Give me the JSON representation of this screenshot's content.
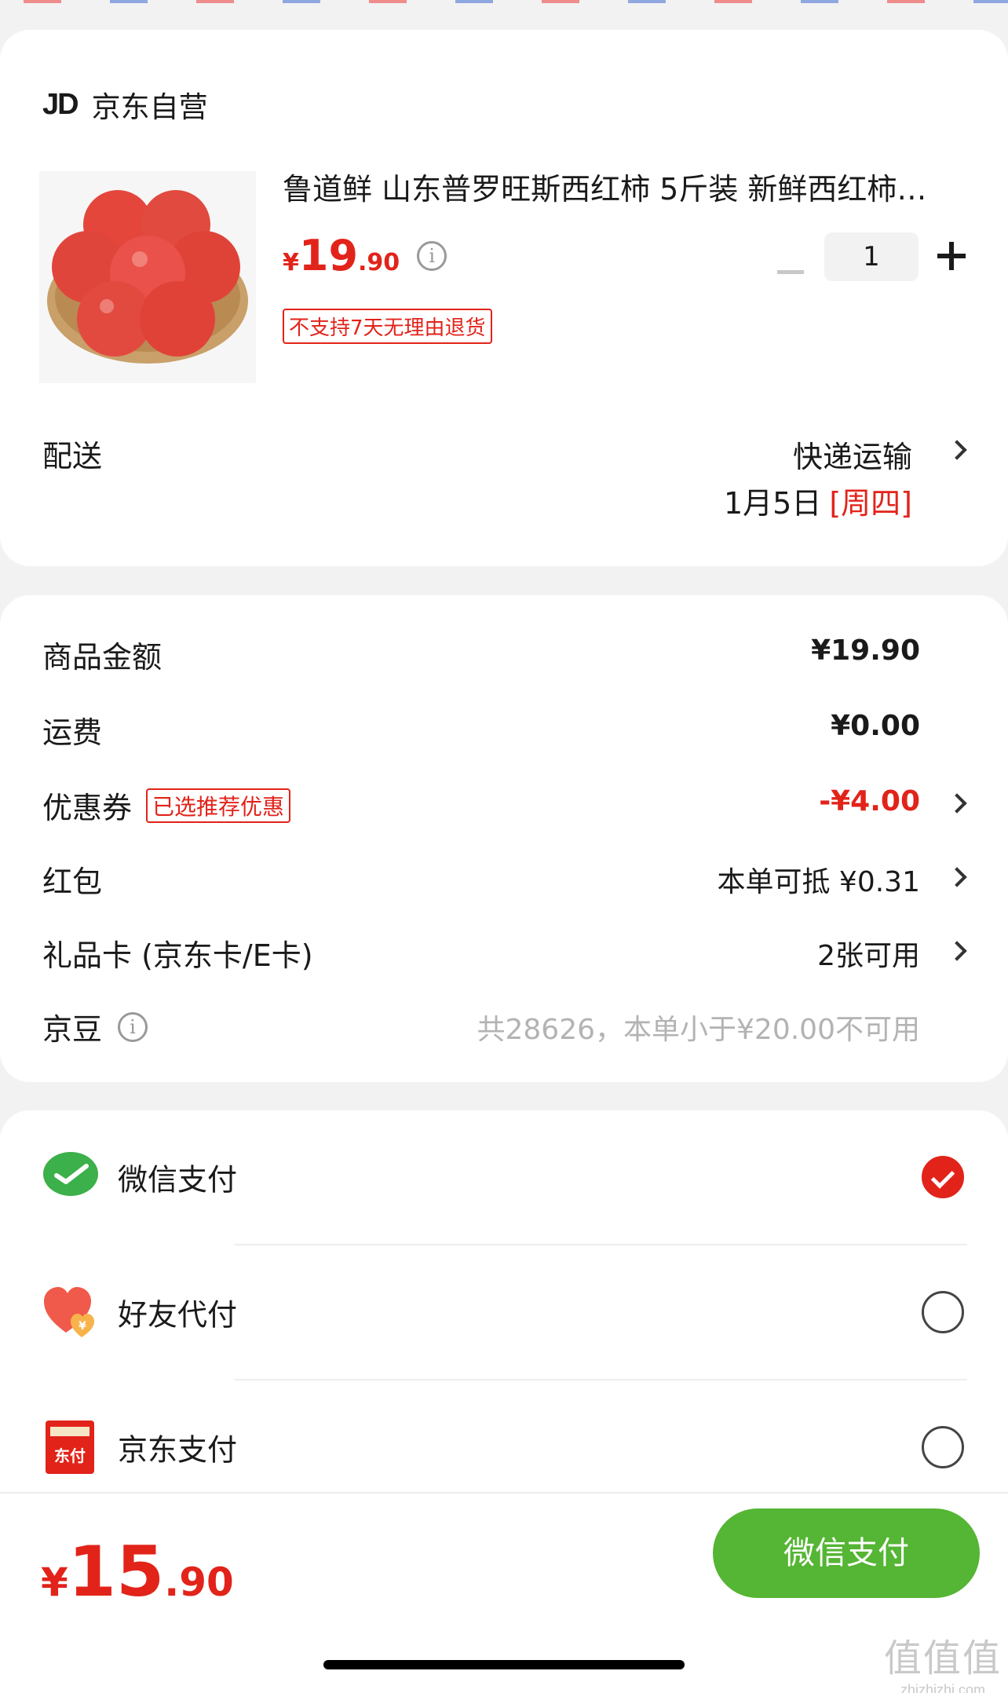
{
  "shop": {
    "logo": "JD",
    "name": "京东自营"
  },
  "product": {
    "title": "鲁道鲜 山东普罗旺斯西红柿 5斤装 新鲜西红柿…",
    "price_currency": "¥",
    "price_int": "19",
    "price_dec": ".90",
    "info_icon": "i",
    "quantity": "1",
    "return_policy": "不支持7天无理由退货"
  },
  "delivery": {
    "label": "配送",
    "method": "快递运输",
    "date": "1月5日",
    "weekday": "[周四]"
  },
  "fees": {
    "goods_label": "商品金额",
    "goods_value": "¥19.90",
    "shipping_label": "运费",
    "shipping_value": "¥0.00",
    "coupon_label": "优惠券",
    "coupon_tag": "已选推荐优惠",
    "coupon_value": "-¥4.00",
    "redpacket_label": "红包",
    "redpacket_value": "本单可抵 ¥0.31",
    "giftcard_label": "礼品卡 (京东卡/E卡)",
    "giftcard_value": "2张可用",
    "jingdou_label": "京豆",
    "jingdou_value": "共28626，本单小于¥20.00不可用"
  },
  "payment": {
    "options": [
      {
        "label": "微信支付",
        "icon": "wechat-pay-icon",
        "selected": true
      },
      {
        "label": "好友代付",
        "icon": "friend-pay-heart-icon",
        "selected": false
      },
      {
        "label": "京东支付",
        "icon": "jd-pay-icon",
        "selected": false,
        "icon_text": "东付"
      }
    ]
  },
  "total": {
    "currency": "¥",
    "int": "15",
    "dec": ".90"
  },
  "submit_label": "微信支付",
  "watermark": {
    "main": "值值值",
    "sub": "zhizhizhi.com"
  },
  "colors": {
    "accent_red": "#e2231a",
    "wechat_green": "#55b534",
    "background": "#f2f2f2"
  }
}
